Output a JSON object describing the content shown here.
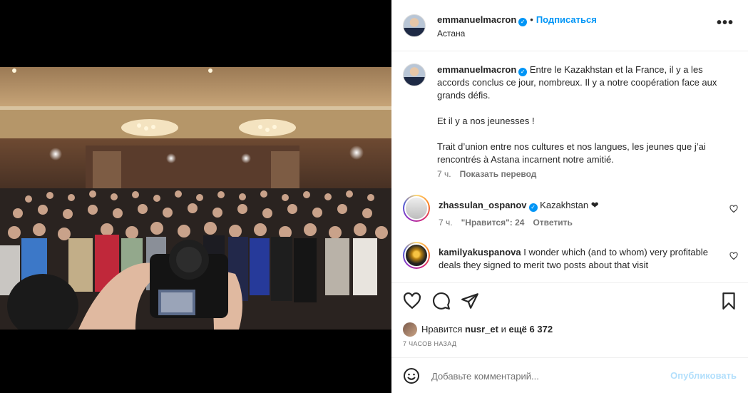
{
  "header": {
    "username": "emmanuelmacron",
    "separator": "•",
    "follow_label": "Подписаться",
    "location": "Астана",
    "more_label": "•••"
  },
  "caption": {
    "username": "emmanuelmacron",
    "paragraph1": "Entre le Kazakhstan et la France, il y a les accords conclus ce jour, nombreux. Il y a notre coopération face aux grands défis.",
    "paragraph2": "Et il y a nos jeunesses !",
    "paragraph3": "Trait d’union entre nos cultures et nos langues, les jeunes que j’ai rencontrés à Astana incarnent notre amitié.",
    "time": "7 ч.",
    "translate_label": "Показать перевод"
  },
  "comments": [
    {
      "username": "zhassulan_ospanov",
      "text": "Kazakhstan ❤",
      "time": "7 ч.",
      "likes_text": "\"Нравится\": 24",
      "reply_label": "Ответить"
    },
    {
      "username": "kamilyakuspanova",
      "text": "I wonder which (and to whom) very profitable deals they signed to merit two posts about that visit"
    }
  ],
  "likes": {
    "prefix": "Нравится",
    "user": "nusr_et",
    "middle": "и",
    "rest": "ещё 6 372"
  },
  "time_ago": "7 ЧАСОВ НАЗАД",
  "add_comment": {
    "placeholder": "Добавьте комментарий...",
    "publish_label": "Опубликовать"
  },
  "icons": {
    "verified": "verified-badge-icon",
    "heart": "heart-icon",
    "comment": "comment-icon",
    "share": "share-icon",
    "save": "bookmark-icon",
    "emoji": "emoji-icon"
  },
  "colors": {
    "accent": "#0095f6",
    "text": "#262626",
    "secondary": "#737373",
    "publish_disabled": "#b2dffc"
  }
}
